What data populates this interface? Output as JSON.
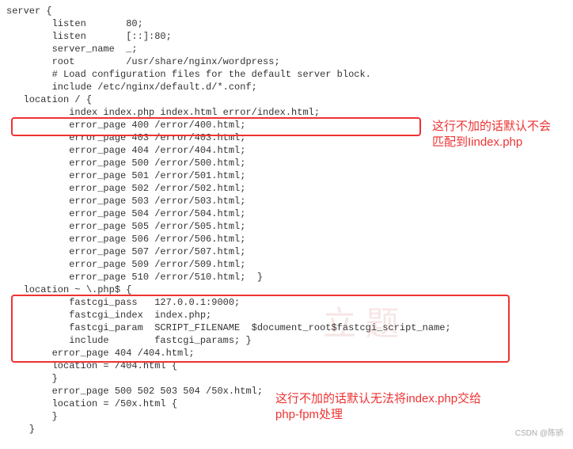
{
  "code": {
    "l1": "server {",
    "l2": "        listen       80;",
    "l3": "        listen       [::]:80;",
    "l4": "        server_name  _;",
    "l5": "        root         /usr/share/nginx/wordpress;",
    "l6": "",
    "l7": "        # Load configuration files for the default server block.",
    "l8": "        include /etc/nginx/default.d/*.conf;",
    "l9": "   location / {",
    "l10": "           index index.php index.html error/index.html;",
    "l11": "           error_page 400 /error/400.html;",
    "l12": "           error_page 403 /error/403.html;",
    "l13": "           error_page 404 /error/404.html;",
    "l14": "           error_page 500 /error/500.html;",
    "l15": "           error_page 501 /error/501.html;",
    "l16": "           error_page 502 /error/502.html;",
    "l17": "           error_page 503 /error/503.html;",
    "l18": "           error_page 504 /error/504.html;",
    "l19": "           error_page 505 /error/505.html;",
    "l20": "           error_page 506 /error/506.html;",
    "l21": "           error_page 507 /error/507.html;",
    "l22": "           error_page 509 /error/509.html;",
    "l23": "           error_page 510 /error/510.html;  }",
    "l24": "   location ~ \\.php$ {",
    "l25": "           fastcgi_pass   127.0.0.1:9000;",
    "l26": "           fastcgi_index  index.php;",
    "l27": "           fastcgi_param  SCRIPT_FILENAME  $document_root$fastcgi_script_name;",
    "l28": "           include        fastcgi_params; }",
    "l29": "        error_page 404 /404.html;",
    "l30": "        location = /404.html {",
    "l31": "        }",
    "l32": "",
    "l33": "        error_page 500 502 503 504 /50x.html;",
    "l34": "        location = /50x.html {",
    "l35": "        }",
    "l36": "    }"
  },
  "annotation1_a": "这行不加的话默认不会",
  "annotation1_b": "匹配到Iindex.php",
  "annotation2_a": "这行不加的话默认无法将index.php交给",
  "annotation2_b": "php-fpm处理",
  "watermark": "立题",
  "credit": "CSDN @陈骄"
}
